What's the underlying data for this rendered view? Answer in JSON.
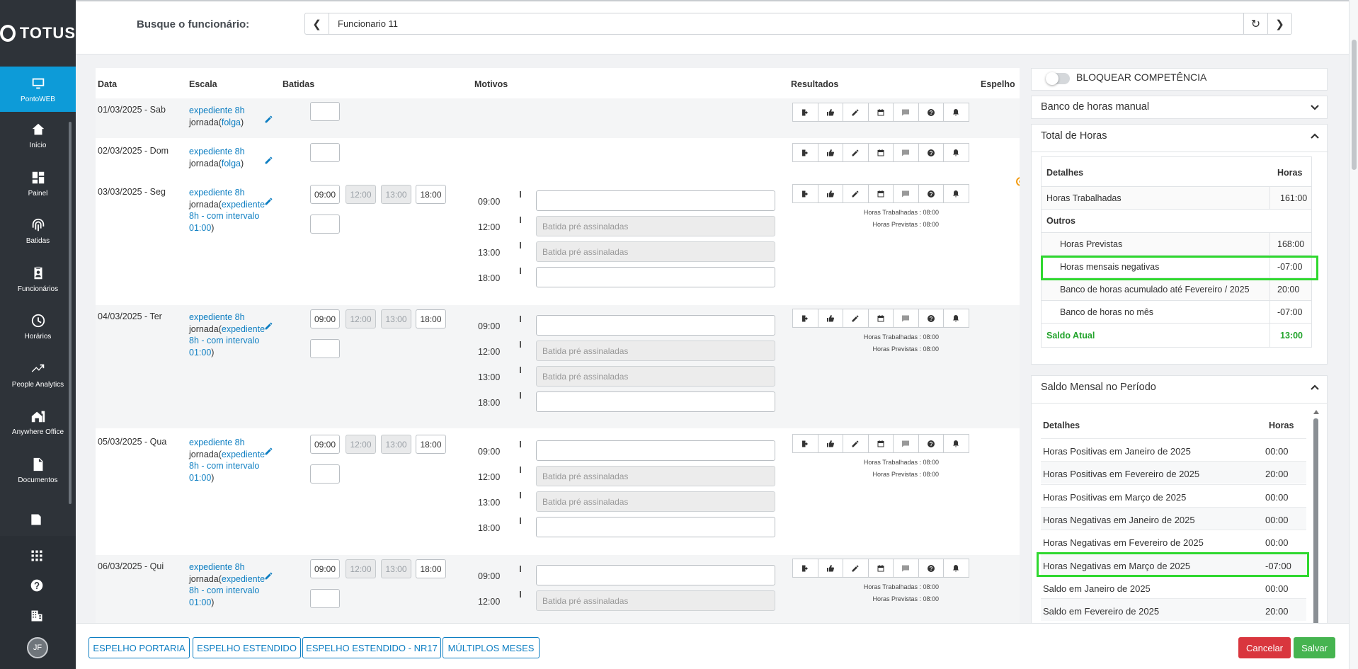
{
  "brand": "TOTUS",
  "sidebar": {
    "items": [
      {
        "label": "PontoWEB",
        "icon": "monitor-icon",
        "active": true
      },
      {
        "label": "Início",
        "icon": "home-icon"
      },
      {
        "label": "Painel",
        "icon": "dashboard-icon"
      },
      {
        "label": "Batidas",
        "icon": "fingerprint-icon"
      },
      {
        "label": "Funcionários",
        "icon": "badge-icon"
      },
      {
        "label": "Horários",
        "icon": "clock-icon"
      },
      {
        "label": "People Analytics",
        "icon": "trend-icon"
      },
      {
        "label": "Anywhere Office",
        "icon": "house-office-icon"
      },
      {
        "label": "Documentos",
        "icon": "document-icon"
      }
    ],
    "avatar_initials": "JF"
  },
  "search": {
    "label": "Busque o funcionário:",
    "value": "Funcionario 11"
  },
  "table": {
    "headers": {
      "data": "Data",
      "escala": "Escala",
      "batidas": "Batidas",
      "motivos": "Motivos",
      "resultados": "Resultados",
      "espelho": "Espelho"
    },
    "pre_assinaladas": "Batida pré assinaladas",
    "days": [
      {
        "date": "01/03/2025 - Sab",
        "escala_1": "expediente 8h",
        "escala_2_prefix": "jornada(",
        "escala_2_link": "folga",
        "escala_2_suffix": ")"
      },
      {
        "date": "02/03/2025 - Dom",
        "escala_1": "expediente 8h",
        "escala_2_prefix": "jornada(",
        "escala_2_link": "folga",
        "escala_2_suffix": ")"
      },
      {
        "date": "03/03/2025 - Seg",
        "escala_1": "expediente 8h",
        "escala_2_prefix": "jornada(",
        "escala_2_link": "expediente",
        "escala_3": "8h - com intervalo",
        "escala_4": "01:00",
        "escala_4_suffix": ")",
        "batidas": [
          "09:00",
          "12:00",
          "13:00",
          "18:00"
        ],
        "motivos_times": [
          "09:00",
          "12:00",
          "13:00",
          "18:00"
        ],
        "trabalhadas": "Horas Trabalhadas : 08:00",
        "previstas": "Horas Previstas : 08:00"
      },
      {
        "date": "04/03/2025 - Ter",
        "escala_1": "expediente 8h",
        "escala_2_prefix": "jornada(",
        "escala_2_link": "expediente",
        "escala_3": "8h - com intervalo",
        "escala_4": "01:00",
        "escala_4_suffix": ")",
        "batidas": [
          "09:00",
          "12:00",
          "13:00",
          "18:00"
        ],
        "motivos_times": [
          "09:00",
          "12:00",
          "13:00",
          "18:00"
        ],
        "trabalhadas": "Horas Trabalhadas : 08:00",
        "previstas": "Horas Previstas : 08:00"
      },
      {
        "date": "05/03/2025 - Qua",
        "escala_1": "expediente 8h",
        "escala_2_prefix": "jornada(",
        "escala_2_link": "expediente",
        "escala_3": "8h - com intervalo",
        "escala_4": "01:00",
        "escala_4_suffix": ")",
        "batidas": [
          "09:00",
          "12:00",
          "13:00",
          "18:00"
        ],
        "motivos_times": [
          "09:00",
          "12:00",
          "13:00",
          "18:00"
        ],
        "trabalhadas": "Horas Trabalhadas : 08:00",
        "previstas": "Horas Previstas : 08:00"
      },
      {
        "date": "06/03/2025 - Qui",
        "escala_1": "expediente 8h",
        "escala_2_prefix": "jornada(",
        "escala_2_link": "expediente",
        "escala_3": "8h - com intervalo",
        "escala_4": "01:00",
        "escala_4_suffix": ")",
        "batidas": [
          "09:00",
          "12:00",
          "13:00",
          "18:00"
        ],
        "motivos_times": [
          "09:00",
          "12:00"
        ],
        "trabalhadas": "Horas Trabalhadas : 08:00",
        "previstas": "Horas Previstas : 08:00"
      }
    ]
  },
  "right": {
    "bloquear": "BLOQUEAR COMPETÊNCIA",
    "banco_manual": "Banco de horas manual",
    "total": {
      "title": "Total de Horas",
      "col_detalhes": "Detalhes",
      "col_horas": "Horas",
      "trabalhadas_label": "Horas Trabalhadas",
      "trabalhadas_value": "161:00",
      "outros": "Outros",
      "rows": [
        {
          "label": "Horas Previstas",
          "value": "168:00"
        },
        {
          "label": "Horas mensais negativas",
          "value": "-07:00"
        },
        {
          "label": "Banco de horas acumulado até Fevereiro / 2025",
          "value": "20:00"
        },
        {
          "label": "Banco de horas no mês",
          "value": "-07:00"
        }
      ],
      "saldo_label": "Saldo Atual",
      "saldo_value": "13:00"
    },
    "mensal": {
      "title": "Saldo Mensal no Período",
      "col_detalhes": "Detalhes",
      "col_horas": "Horas",
      "rows": [
        {
          "label": "Horas Positivas em Janeiro de 2025",
          "value": "00:00"
        },
        {
          "label": "Horas Positivas em Fevereiro de 2025",
          "value": "20:00"
        },
        {
          "label": "Horas Positivas em Março de 2025",
          "value": "00:00"
        },
        {
          "label": "Horas Negativas em Janeiro de 2025",
          "value": "00:00"
        },
        {
          "label": "Horas Negativas em Fevereiro de 2025",
          "value": "00:00"
        },
        {
          "label": "Horas Negativas em Março de 2025",
          "value": "-07:00"
        },
        {
          "label": "Saldo em Janeiro de 2025",
          "value": "00:00"
        },
        {
          "label": "Saldo em Fevereiro de 2025",
          "value": "20:00"
        }
      ]
    }
  },
  "footer": {
    "btn1": "ESPELHO PORTARIA",
    "btn2": "ESPELHO ESTENDIDO",
    "btn3": "ESPELHO ESTENDIDO - NR17",
    "btn4": "MÚLTIPLOS MESES",
    "cancel": "Cancelar",
    "save": "Salvar"
  }
}
